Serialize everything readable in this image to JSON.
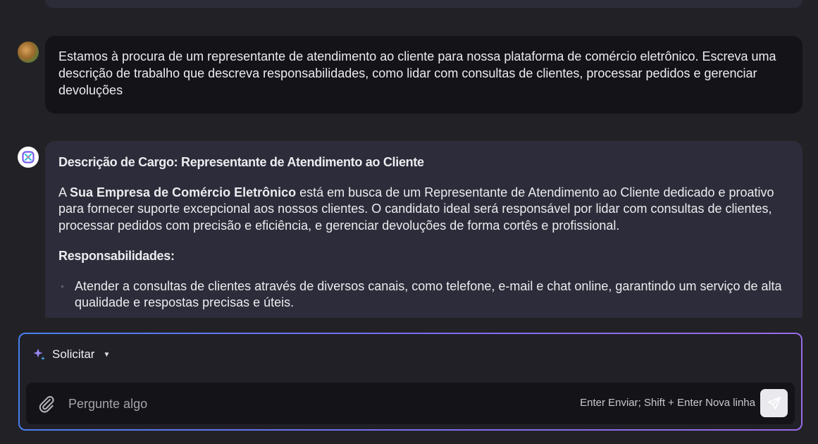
{
  "conversation": {
    "user_message": "Estamos à procura de um representante de atendimento ao cliente para nossa plataforma de comércio eletrônico. Escreva uma descrição de trabalho que descreva responsabilidades, como lidar com consultas de clientes, processar pedidos e gerenciar devoluções",
    "ai_response": {
      "title": "Descrição de Cargo: Representante de Atendimento ao Cliente",
      "intro_prefix": "A ",
      "intro_company": "Sua Empresa de Comércio Eletrônico",
      "intro_rest": " está em busca de um Representante de Atendimento ao Cliente dedicado e proativo para fornecer suporte excepcional aos nossos clientes. O candidato ideal será responsável por lidar com consultas de clientes, processar pedidos com precisão e eficiência, e gerenciar devoluções de forma cortês e profissional.",
      "responsibilities_heading": "Responsabilidades:",
      "responsibilities": [
        "Atender a consultas de clientes através de diversos canais, como telefone, e-mail e chat online, garantindo um serviço de alta qualidade e respostas precisas e úteis."
      ]
    }
  },
  "composer": {
    "mode_label": "Solicitar",
    "placeholder": "Pergunte algo",
    "hint": "Enter Enviar; Shift + Enter Nova linha"
  },
  "icons": {
    "mode": "sparkle-icon",
    "mode_dropdown": "caret-down-icon",
    "attach": "paperclip-icon",
    "send": "send-icon",
    "assistant_avatar": "assistant-logo-icon",
    "user_avatar": "user-photo-avatar"
  },
  "colors": {
    "background": "#222226",
    "user_bubble": "#141418",
    "ai_bubble": "#2c2c3a",
    "composer_border_start": "#4a7ef0",
    "composer_border_end": "#9a6ae8",
    "send_button": "#e9e9ee"
  }
}
